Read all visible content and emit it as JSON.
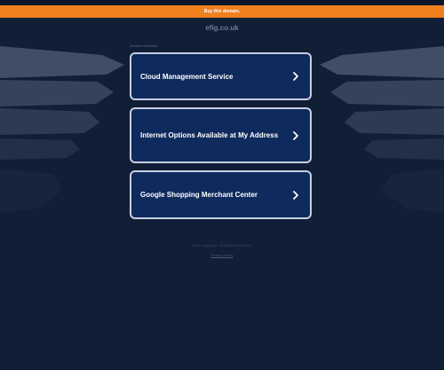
{
  "banner": {
    "text": "Buy this domain."
  },
  "domain": {
    "name": "efig.co.uk"
  },
  "related": {
    "label": "Related searches",
    "items": [
      {
        "label": "Cloud Management Service"
      },
      {
        "label": "Internet Options Available at My Address"
      },
      {
        "label": "Google Shopping Merchant Center"
      }
    ]
  },
  "footer": {
    "copyright": "2025 Copyright . All Rights Reserved.",
    "privacy": "Privacy Policy"
  },
  "colors": {
    "background": "#101e36",
    "banner": "#f07f1e",
    "button_bg": "#0f2a5c",
    "button_border": "#c7d0e2"
  },
  "icons": {
    "result_arrow": "chevron-right-icon"
  }
}
